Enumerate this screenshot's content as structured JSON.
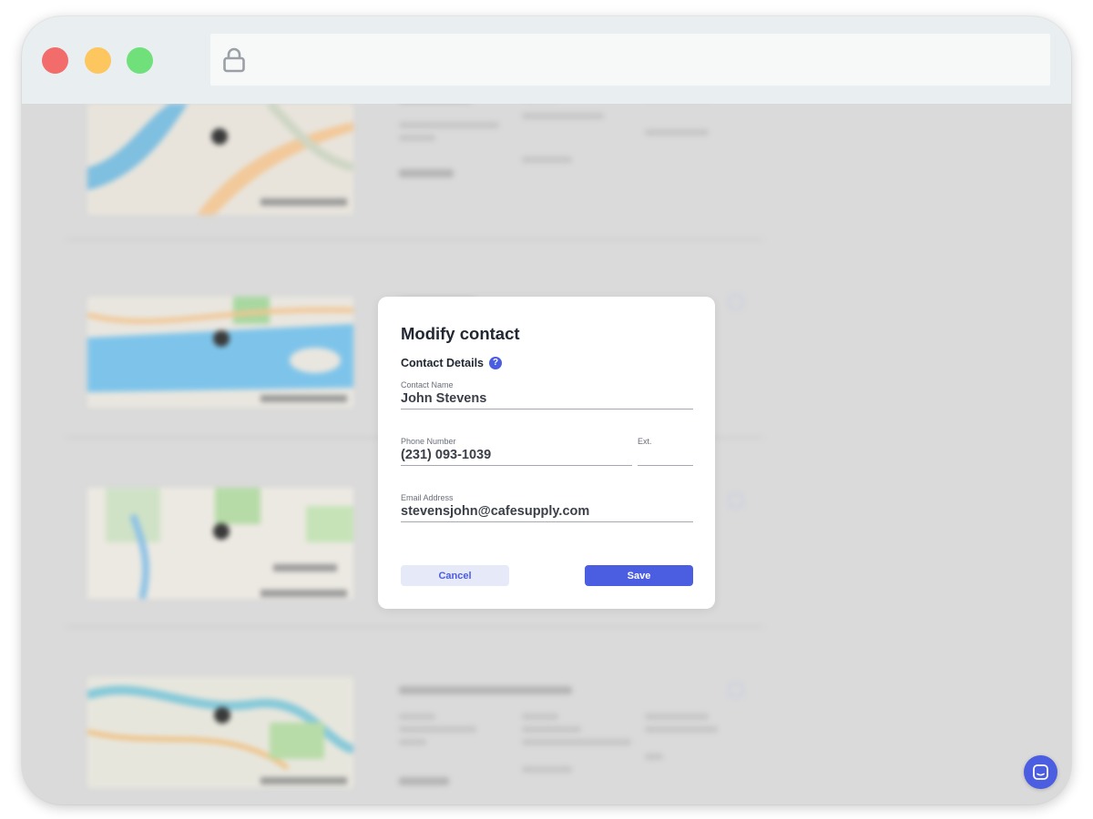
{
  "browser": {
    "address_bar": {
      "url": ""
    }
  },
  "modal": {
    "title": "Modify contact",
    "section_label": "Contact Details",
    "help_icon_glyph": "?",
    "fields": {
      "contact_name": {
        "label": "Contact Name",
        "value": "John Stevens"
      },
      "phone_number": {
        "label": "Phone Number",
        "value": "(231) 093-1039"
      },
      "extension": {
        "label": "Ext.",
        "value": ""
      },
      "email_address": {
        "label": "Email Address",
        "value": "stevensjohn@cafesupply.com"
      }
    },
    "buttons": {
      "cancel_label": "Cancel",
      "save_label": "Save"
    }
  },
  "icons": {
    "lock": "lock-icon",
    "help": "help-icon",
    "chat": "chat-icon"
  },
  "colors": {
    "accent": "#4b5de0",
    "cancel_bg": "#e6e9f7",
    "dot_close": "#f26c6c",
    "dot_minimize": "#fdc65f",
    "dot_zoom": "#6fe07a",
    "backdrop": "#dadada"
  }
}
